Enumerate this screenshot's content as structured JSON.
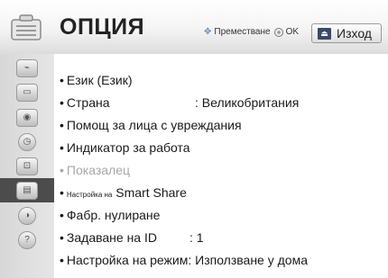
{
  "header": {
    "title": "ОПЦИЯ",
    "nav_hint": "Преместване",
    "ok_label": "OK",
    "exit_key": "⏏",
    "exit_label": "Изход"
  },
  "sidebar": {
    "items": [
      {
        "name": "satellite-icon",
        "glyph": "⌁"
      },
      {
        "name": "picture-icon",
        "glyph": "▭"
      },
      {
        "name": "audio-icon",
        "glyph": "◉"
      },
      {
        "name": "time-icon",
        "glyph": "◷"
      },
      {
        "name": "lock-icon",
        "glyph": "⊡"
      },
      {
        "name": "option-icon",
        "glyph": "▤"
      },
      {
        "name": "network-icon",
        "glyph": "◑"
      },
      {
        "name": "support-icon",
        "glyph": "?"
      }
    ]
  },
  "menu": {
    "items": [
      {
        "label": "Език (Език)",
        "value": ""
      },
      {
        "label": "Страна",
        "value": ": Великобритания"
      },
      {
        "label": "Помощ за лица с увреждания",
        "value": ""
      },
      {
        "label": "Индикатор за работа",
        "value": ""
      },
      {
        "label": "Показалец",
        "value": "",
        "disabled": true
      },
      {
        "label_small": "Настройка на",
        "label": "Smart Share",
        "value": ""
      },
      {
        "label": "Фабр. нулиране",
        "value": ""
      },
      {
        "label": "Задаване на ID",
        "value": ": 1"
      },
      {
        "label": "Настройка на режим: Използване у дома",
        "value": ""
      }
    ]
  },
  "colors": {
    "sidebar_active": "#4c4c4c",
    "exit_key": "#3a4b66",
    "disabled_text": "#a8a8a8"
  }
}
